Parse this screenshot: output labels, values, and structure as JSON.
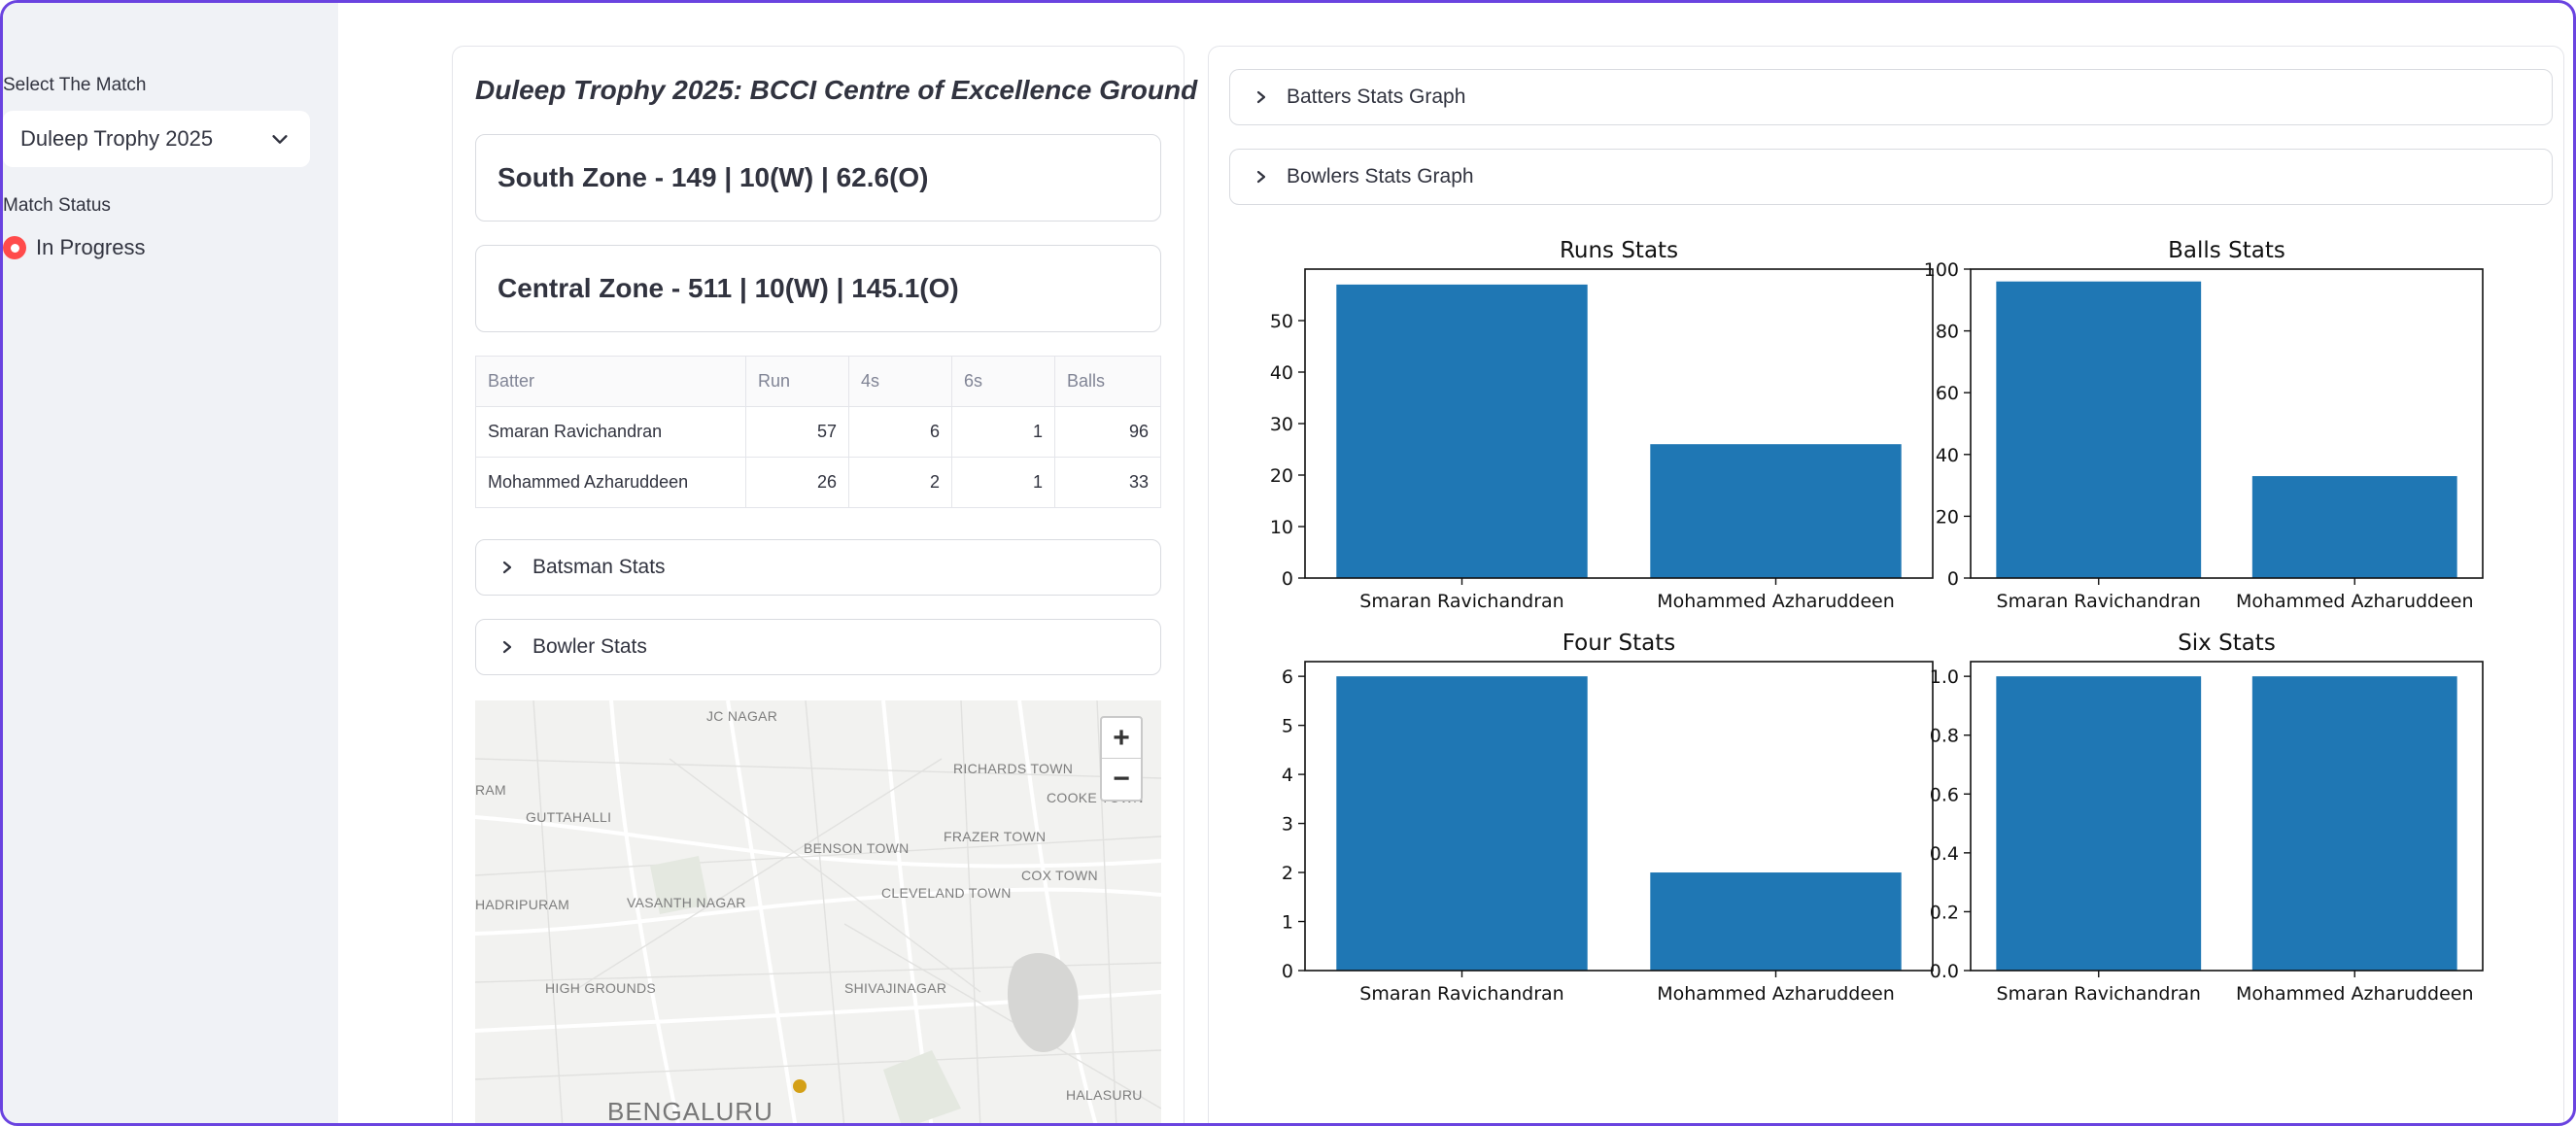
{
  "sidebar": {
    "match_label": "Select The Match",
    "match_selected": "Duleep Trophy 2025",
    "status_label": "Match Status",
    "status_value": "In Progress"
  },
  "main": {
    "title": "Duleep Trophy 2025: BCCI Centre of Excellence Ground",
    "scores": [
      "South Zone - 149 | 10(W) | 62.6(O)",
      "Central Zone - 511 | 10(W) | 145.1(O)"
    ],
    "batters_table": {
      "headers": [
        "Batter",
        "Run",
        "4s",
        "6s",
        "Balls"
      ],
      "rows": [
        [
          "Smaran Ravichandran",
          "57",
          "6",
          "1",
          "96"
        ],
        [
          "Mohammed Azharuddeen",
          "26",
          "2",
          "1",
          "33"
        ]
      ]
    },
    "expanders": [
      "Batsman Stats",
      "Bowler Stats"
    ],
    "map": {
      "labels": [
        "JC NAGAR",
        "RICHARDS TOWN",
        "COOKE TOWN",
        "RAM",
        "GUTTAHALLI",
        "BENSON TOWN",
        "FRAZER TOWN",
        "COX TOWN",
        "HADRIPURAM",
        "VASANTH NAGAR",
        "CLEVELAND TOWN",
        "HIGH GROUNDS",
        "SHIVAJINAGAR",
        "HALASURU",
        "BENGALURU"
      ],
      "zoom_in": "+",
      "zoom_out": "−",
      "marker_color": "#d4a017"
    }
  },
  "right": {
    "expanders": [
      "Batters Stats Graph",
      "Bowlers Stats Graph"
    ]
  },
  "chart_data": [
    {
      "type": "bar",
      "title": "Runs Stats",
      "categories": [
        "Smaran Ravichandran",
        "Mohammed Azharuddeen"
      ],
      "values": [
        57,
        26
      ],
      "ylim": [
        0,
        60
      ],
      "yticks": [
        0,
        10,
        20,
        30,
        40,
        50
      ],
      "ytick_labels": [
        "0",
        "10",
        "20",
        "30",
        "40",
        "50"
      ],
      "color": "#1f77b4"
    },
    {
      "type": "bar",
      "title": "Balls Stats",
      "categories": [
        "Smaran Ravichandran",
        "Mohammed Azharuddeen"
      ],
      "values": [
        96,
        33
      ],
      "ylim": [
        0,
        100
      ],
      "yticks": [
        0,
        20,
        40,
        60,
        80,
        100
      ],
      "ytick_labels": [
        "0",
        "20",
        "40",
        "60",
        "80",
        "100"
      ],
      "color": "#1f77b4"
    },
    {
      "type": "bar",
      "title": "Four Stats",
      "categories": [
        "Smaran Ravichandran",
        "Mohammed Azharuddeen"
      ],
      "values": [
        6,
        2
      ],
      "ylim": [
        0,
        6.3
      ],
      "yticks": [
        0,
        1,
        2,
        3,
        4,
        5,
        6
      ],
      "ytick_labels": [
        "0",
        "1",
        "2",
        "3",
        "4",
        "5",
        "6"
      ],
      "color": "#1f77b4"
    },
    {
      "type": "bar",
      "title": "Six Stats",
      "categories": [
        "Smaran Ravichandran",
        "Mohammed Azharuddeen"
      ],
      "values": [
        1,
        1
      ],
      "ylim": [
        0,
        1.05
      ],
      "yticks": [
        0,
        0.2,
        0.4,
        0.6,
        0.8,
        1.0
      ],
      "ytick_labels": [
        "0.0",
        "0.2",
        "0.4",
        "0.6",
        "0.8",
        "1.0"
      ],
      "color": "#1f77b4"
    }
  ]
}
